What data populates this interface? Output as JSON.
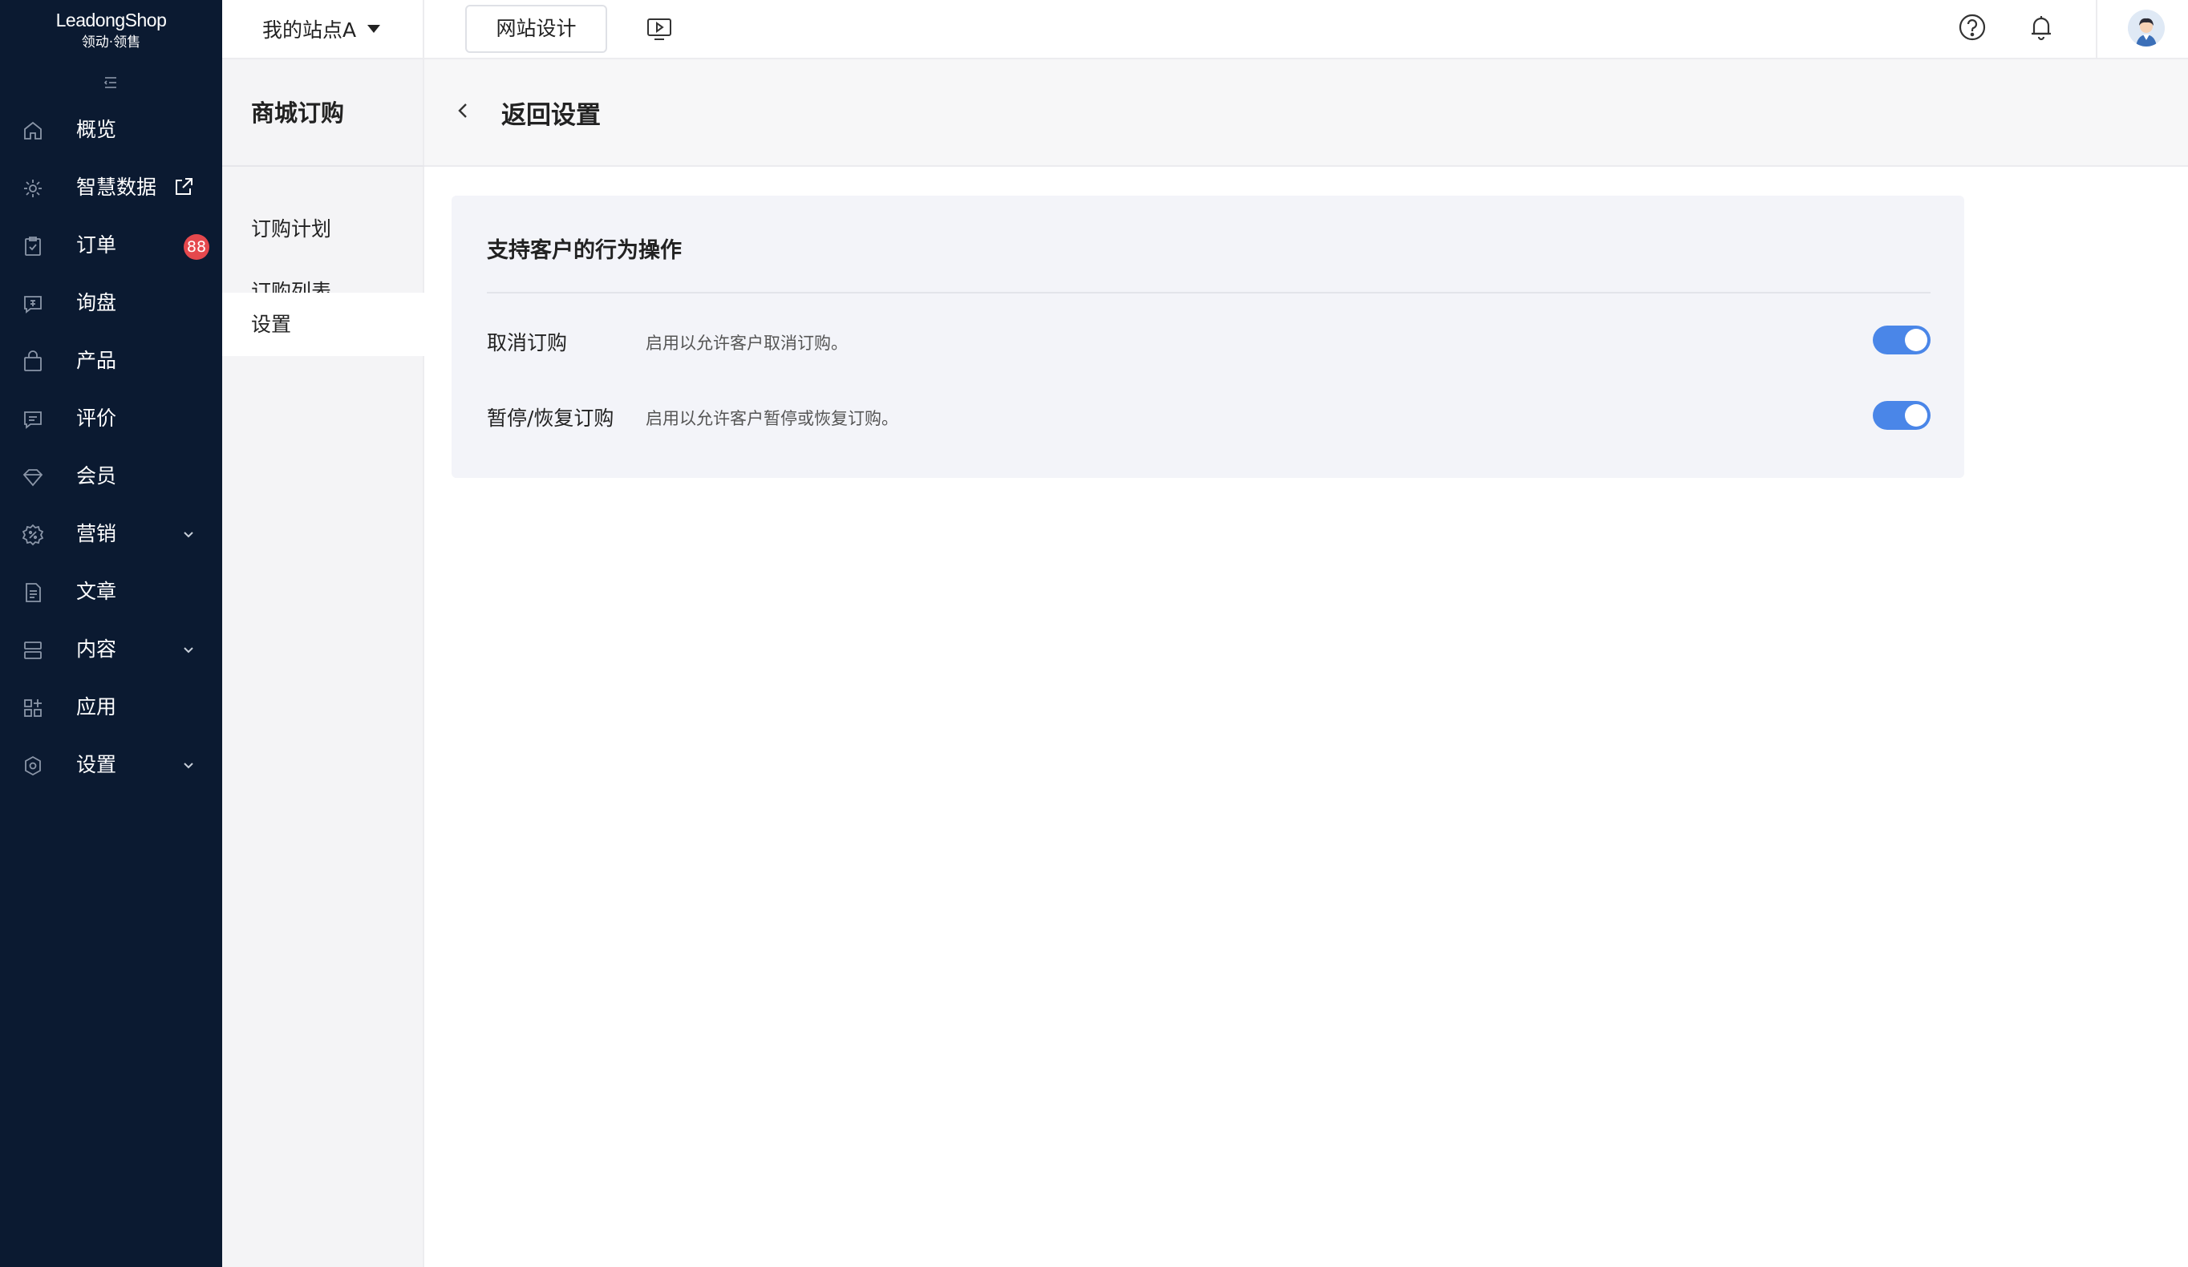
{
  "brand": {
    "name": "LeadongShop",
    "subtitle": "领动·领售"
  },
  "nav": {
    "items": [
      {
        "label": "概览",
        "icon": "home-icon"
      },
      {
        "label": "智慧数据",
        "icon": "data-icon",
        "external": true
      },
      {
        "label": "订单",
        "icon": "order-icon",
        "badge": "88"
      },
      {
        "label": "询盘",
        "icon": "inquiry-icon"
      },
      {
        "label": "产品",
        "icon": "bag-icon"
      },
      {
        "label": "评价",
        "icon": "comment-icon"
      },
      {
        "label": "会员",
        "icon": "diamond-icon"
      },
      {
        "label": "营销",
        "icon": "marketing-icon",
        "expandable": true
      },
      {
        "label": "文章",
        "icon": "article-icon"
      },
      {
        "label": "内容",
        "icon": "content-icon",
        "expandable": true
      },
      {
        "label": "应用",
        "icon": "apps-icon"
      },
      {
        "label": "设置",
        "icon": "settings-icon",
        "expandable": true
      }
    ]
  },
  "header": {
    "site_name": "我的站点A",
    "design_button": "网站设计"
  },
  "subnav": {
    "title": "商城订购",
    "items": [
      {
        "label": "订购计划",
        "active": false
      },
      {
        "label": "订购列表",
        "active": false
      },
      {
        "label": "设置",
        "active": true
      }
    ]
  },
  "page": {
    "title": "返回设置",
    "card": {
      "title": "支持客户的行为操作",
      "settings": [
        {
          "name": "取消订购",
          "description": "启用以允许客户取消订购。",
          "enabled": true
        },
        {
          "name": "暂停/恢复订购",
          "description": "启用以允许客户暂停或恢复订购。",
          "enabled": true
        }
      ]
    }
  },
  "colors": {
    "nav_bg": "#0b1a31",
    "accent": "#4a86e8",
    "badge": "#e5484d"
  }
}
